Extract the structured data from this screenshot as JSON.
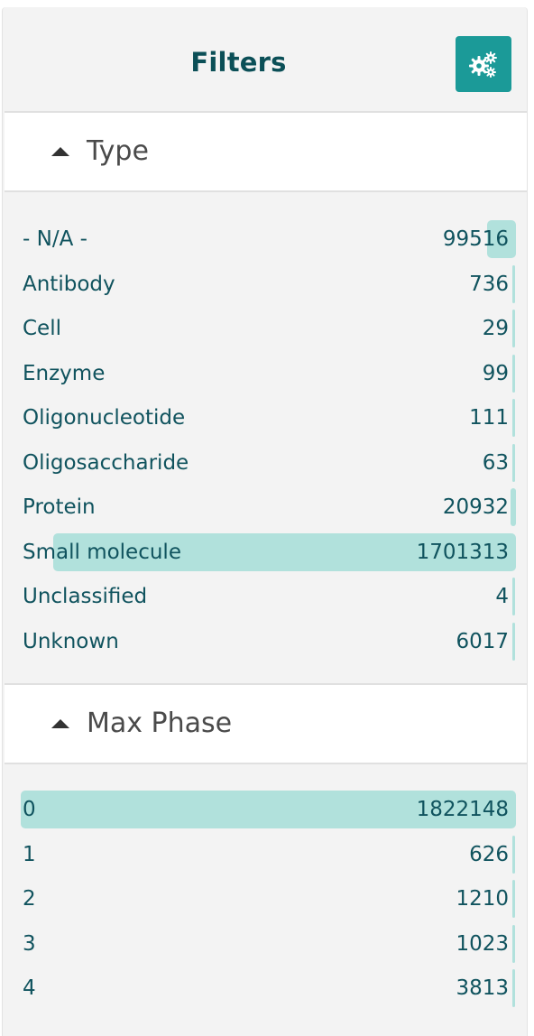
{
  "header": {
    "title": "Filters",
    "settings_icon": "gears-icon",
    "accent_color": "#1b9a98"
  },
  "sections": [
    {
      "title": "Type",
      "expanded": true,
      "items": [
        {
          "label": "- N/A -",
          "count": "99516",
          "fraction": 0.0584
        },
        {
          "label": "Antibody",
          "count": "736",
          "fraction": 0.0004
        },
        {
          "label": "Cell",
          "count": "29",
          "fraction": 2e-05
        },
        {
          "label": "Enzyme",
          "count": "99",
          "fraction": 6e-05
        },
        {
          "label": "Oligonucleotide",
          "count": "111",
          "fraction": 7e-05
        },
        {
          "label": "Oligosaccharide",
          "count": "63",
          "fraction": 4e-05
        },
        {
          "label": "Protein",
          "count": "20932",
          "fraction": 0.0123
        },
        {
          "label": "Small molecule",
          "count": "1701313",
          "fraction": 1.0
        },
        {
          "label": "Unclassified",
          "count": "4",
          "fraction": 2e-06
        },
        {
          "label": "Unknown",
          "count": "6017",
          "fraction": 0.0035
        }
      ]
    },
    {
      "title": "Max Phase",
      "expanded": true,
      "items": [
        {
          "label": "0",
          "count": "1822148",
          "fraction": 1.0
        },
        {
          "label": "1",
          "count": "626",
          "fraction": 0.0003
        },
        {
          "label": "2",
          "count": "1210",
          "fraction": 0.0007
        },
        {
          "label": "3",
          "count": "1023",
          "fraction": 0.0006
        },
        {
          "label": "4",
          "count": "3813",
          "fraction": 0.0021
        }
      ]
    }
  ]
}
